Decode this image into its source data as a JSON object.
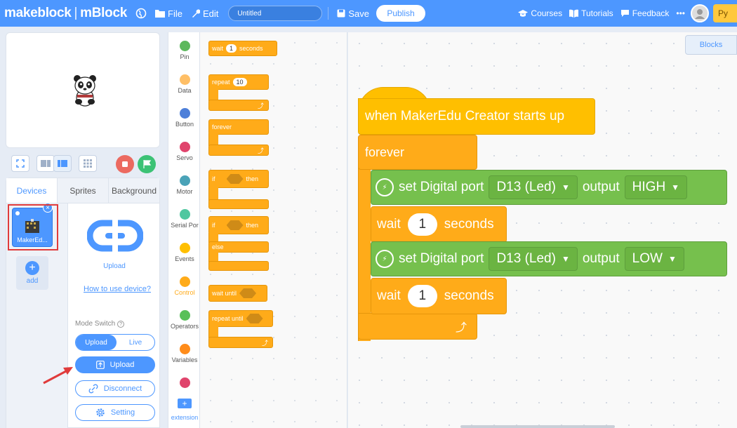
{
  "header": {
    "brand": "makeblock",
    "product": "mBlock",
    "file_label": "File",
    "edit_label": "Edit",
    "project_title": "Untitled",
    "save_label": "Save",
    "publish_label": "Publish",
    "courses_label": "Courses",
    "tutorials_label": "Tutorials",
    "feedback_label": "Feedback",
    "more_label": "•••",
    "python_label": "Py"
  },
  "panel_tabs": [
    "Devices",
    "Sprites",
    "Background"
  ],
  "devices": {
    "device_name": "MakerEd...",
    "add_label": "add",
    "upload_caption": "Upload",
    "howto_link": "How to use device?",
    "mode_switch_label": "Mode Switch",
    "mode_upload": "Upload",
    "mode_live": "Live",
    "upload_button": "Upload",
    "disconnect_button": "Disconnect",
    "setting_button": "Setting"
  },
  "categories": [
    {
      "label": "Pin",
      "color": "#5cb85c"
    },
    {
      "label": "Data",
      "color": "#ffbf66"
    },
    {
      "label": "Button",
      "color": "#4d7fd9"
    },
    {
      "label": "Servo",
      "color": "#e0446c"
    },
    {
      "label": "Motor",
      "color": "#4aa3b8"
    },
    {
      "label": "Serial Por",
      "color": "#4fc7a0"
    },
    {
      "label": "Events",
      "color": "#ffbf00"
    },
    {
      "label": "Control",
      "color": "#ffab19"
    },
    {
      "label": "Operators",
      "color": "#59c059"
    },
    {
      "label": "Variables",
      "color": "#ff8c1a"
    },
    {
      "label": "",
      "color": "#e0446c"
    }
  ],
  "extension_label": "extension",
  "palette": {
    "wait": "wait",
    "wait_value": "1",
    "seconds": "seconds",
    "repeat": "repeat",
    "repeat_value": "10",
    "forever": "forever",
    "if": "if",
    "then": "then",
    "else": "else",
    "wait_until": "wait until",
    "repeat_until": "repeat until"
  },
  "workspace": {
    "blocks_tab": "Blocks",
    "hat": "when MakerEdu Creator starts up",
    "forever": "forever",
    "set_port": "set Digital port",
    "port_value": "D13 (Led)",
    "output": "output",
    "high": "HIGH",
    "low": "LOW",
    "wait": "wait",
    "wait_value": "1",
    "seconds": "seconds"
  },
  "colors": {
    "accent": "#4d97ff",
    "control": "#ffab19",
    "events": "#ffbf00",
    "pin": "#76c04d",
    "highlight": "#e03b3b"
  }
}
